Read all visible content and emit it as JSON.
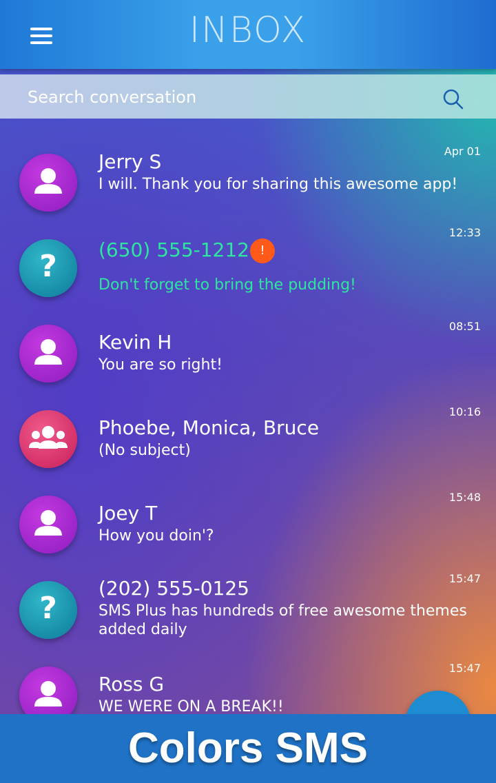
{
  "header": {
    "title": "INBOX",
    "menu_icon": "hamburger-menu-icon"
  },
  "search": {
    "placeholder": "Search conversation",
    "icon": "search-icon"
  },
  "conversations": [
    {
      "name": "Jerry S",
      "preview": " I will. Thank you for sharing this awesome app!",
      "time": "Apr 01",
      "avatar": "person"
    },
    {
      "name": "(650) 555-1212",
      "preview": "Don't forget to bring the pudding!",
      "time": "12:33",
      "avatar": "unknown",
      "alert": "!",
      "highlight_color": "#2ee6a0"
    },
    {
      "name": "Kevin H",
      "preview": "You are so right!",
      "time": "08:51",
      "avatar": "person"
    },
    {
      "name": "Phoebe, Monica, Bruce",
      "preview": "(No subject)",
      "time": "10:16",
      "avatar": "group"
    },
    {
      "name": "Joey T",
      "preview": " How you doin'?",
      "time": "15:48",
      "avatar": "person"
    },
    {
      "name": "(202) 555-0125",
      "preview": " SMS Plus has hundreds of free awesome themes added daily",
      "time": "15:47",
      "avatar": "unknown"
    },
    {
      "name": "Ross G",
      "preview": " WE WERE ON A BREAK!!",
      "time": "15:47",
      "avatar": "person"
    }
  ],
  "fab": {
    "icon": "compose-plus-icon"
  },
  "banner": {
    "text": "Colors SMS"
  },
  "colors": {
    "topbar": "#3aa0ea",
    "banner": "#1f72c6",
    "alert": "#ff5a1a",
    "unknown_text": "#2ee6a0"
  }
}
